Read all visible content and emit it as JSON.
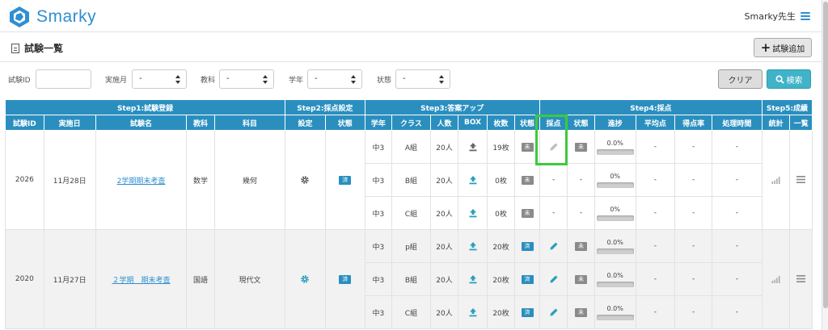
{
  "app": {
    "name": "Smarky",
    "user": "Smarky先生",
    "accent": "#2a8fbf"
  },
  "page": {
    "title": "試験一覧",
    "add_button": "試験追加"
  },
  "filters": {
    "exam_id_label": "試験ID",
    "month_label": "実施月",
    "subject_label": "教科",
    "grade_label": "学年",
    "status_label": "状態",
    "month_value": "-",
    "subject_value": "-",
    "grade_value": "-",
    "status_value": "-",
    "clear_button": "クリア",
    "search_button": "検索"
  },
  "table": {
    "groups": {
      "step1": "Step1:試験登録",
      "step2": "Step2:採点設定",
      "step3": "Step3:答案アップ",
      "step4": "Step4:採点",
      "step5": "Step5:成績"
    },
    "columns": {
      "exam_id": "試験ID",
      "date": "実施日",
      "exam_name": "試験名",
      "subject": "教科",
      "topic": "科目",
      "setting": "設定",
      "setting_status": "状態",
      "grade": "学年",
      "class": "クラス",
      "people": "人数",
      "box": "BOX",
      "sheets": "枚数",
      "upload_status": "状態",
      "scoring": "採点",
      "scoring_status": "状態",
      "progress": "進捗",
      "average": "平均点",
      "score_rate": "得点率",
      "processing_time": "処理時間",
      "stats": "統計",
      "list": "一覧"
    },
    "exams": [
      {
        "id": "2026",
        "date": "11月28日",
        "name": "2学期期末考査",
        "subject": "数学",
        "topic": "幾何",
        "setting_status": "済",
        "classes": [
          {
            "grade": "中3",
            "class": "A組",
            "people": "20人",
            "sheets": "19枚",
            "upload_status": "未",
            "scoring_status": "未",
            "progress_label": "0.0%",
            "progress": 0,
            "average": "-",
            "score_rate": "-",
            "time": "-"
          },
          {
            "grade": "中3",
            "class": "B組",
            "people": "20人",
            "sheets": "0枚",
            "upload_status": "未",
            "scoring_dash": "-",
            "scoring_status_dash": "-",
            "progress_label": "0%",
            "progress": 0,
            "average": "-",
            "score_rate": "-",
            "time": "-"
          },
          {
            "grade": "中3",
            "class": "C組",
            "people": "20人",
            "sheets": "0枚",
            "upload_status": "未",
            "scoring_dash": "-",
            "scoring_status_dash": "-",
            "progress_label": "0%",
            "progress": 0,
            "average": "-",
            "score_rate": "-",
            "time": "-"
          }
        ]
      },
      {
        "id": "2020",
        "date": "11月27日",
        "name": "２学期　期末考査",
        "subject": "国語",
        "topic": "現代文",
        "setting_status": "済",
        "classes": [
          {
            "grade": "中3",
            "class": "p組",
            "people": "20人",
            "sheets": "20枚",
            "upload_status": "済",
            "scoring_status": "未",
            "progress_label": "0.0%",
            "progress": 0,
            "average": "-",
            "score_rate": "-",
            "time": "-"
          },
          {
            "grade": "中3",
            "class": "B組",
            "people": "20人",
            "sheets": "20枚",
            "upload_status": "済",
            "scoring_status": "未",
            "progress_label": "0.0%",
            "progress": 0,
            "average": "-",
            "score_rate": "-",
            "time": "-"
          },
          {
            "grade": "中3",
            "class": "C組",
            "people": "20人",
            "sheets": "20枚",
            "upload_status": "済",
            "scoring_status": "未",
            "progress_label": "0.0%",
            "progress": 0,
            "average": "-",
            "score_rate": "-",
            "time": "-"
          }
        ]
      }
    ]
  }
}
